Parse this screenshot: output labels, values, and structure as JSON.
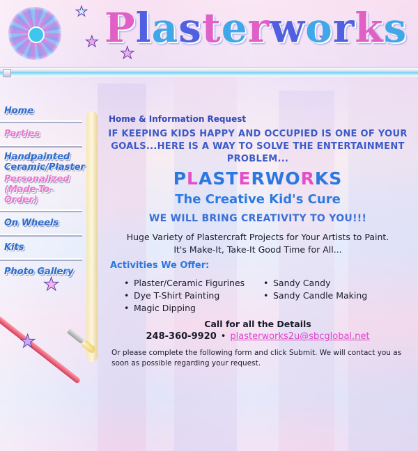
{
  "header": {
    "brand_letters": [
      "P",
      "l",
      "a",
      "s",
      "t",
      "e",
      "r",
      "w",
      "o",
      "r",
      "k",
      "s"
    ]
  },
  "sidebar": {
    "items": [
      {
        "label": "Home"
      },
      {
        "label": "Parties"
      },
      {
        "label": "Handpainted Ceramic/Plaster"
      },
      {
        "label": "Personalized (Made-To-Order)"
      },
      {
        "label": "On Wheels"
      },
      {
        "label": "Kits"
      },
      {
        "label": "Photo Gallery"
      }
    ]
  },
  "main": {
    "breadcrumb": "Home & Information Request",
    "intro": "IF KEEPING KIDS HAPPY AND OCCUPIED IS ONE OF YOUR GOALS...HERE IS A WAY TO SOLVE THE ENTERTAINMENT PROBLEM...",
    "big_brand_letters": [
      "P",
      "L",
      "A",
      "S",
      "T",
      "E",
      "R",
      "W",
      "O",
      "R",
      "K",
      "S"
    ],
    "tagline": "The Creative Kid's Cure",
    "bring": "WE WILL BRING CREATIVITY TO YOU!!!",
    "variety_line1": "Huge Variety of Plastercraft Projects for Your Artists to Paint.",
    "variety_line2": "It's Make-It, Take-It Good Time for All...",
    "activities_heading": "Activities We Offer:",
    "activities_col1": [
      "Plaster/Ceramic Figurines",
      "Dye T-Shirt Painting",
      "Magic Dipping"
    ],
    "activities_col2": [
      "Sandy Candy",
      "Sandy Candle Making"
    ],
    "call_heading": "Call for all the Details",
    "phone": "248-360-9920",
    "separator": "•",
    "email": "plasterworks2u@sbcglobal.net",
    "form_note": "Or please complete the following form and click Submit. We will contact you as soon as possible regarding your request."
  },
  "colors": {
    "nav_blue": "#2c6fd0",
    "nav_pink": "#f079d2",
    "heading_blue": "#2c78e0",
    "brand_pink": "#e24fc8",
    "email_pink": "#e040c8"
  }
}
